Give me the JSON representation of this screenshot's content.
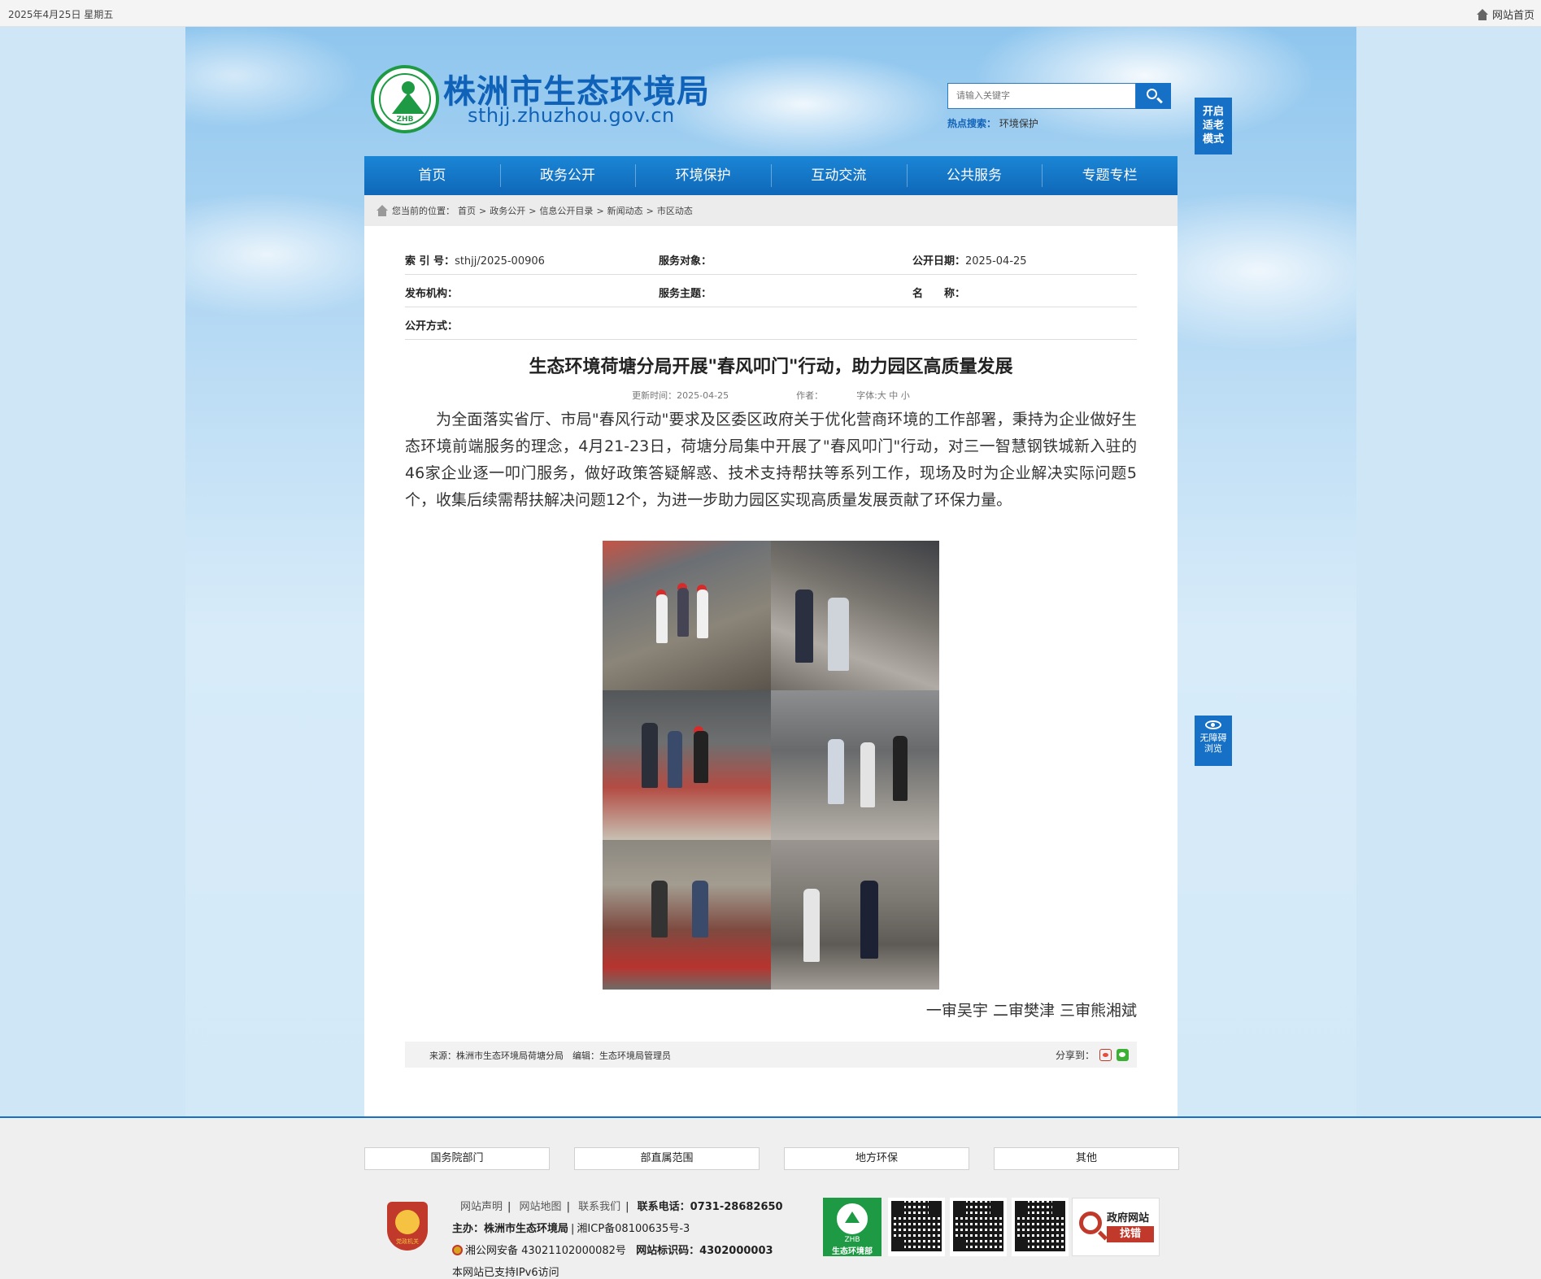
{
  "topbar": {
    "date": "2025年4月25日 星期五",
    "home_link": "网站首页"
  },
  "header": {
    "logo_text": "ZHB",
    "title": "株洲市生态环境局",
    "url": "sthjj.zhuzhou.gov.cn",
    "search_placeholder": "请输入关键字",
    "hot_label": "热点搜索：",
    "hot_term": "环境保护",
    "elder_mode": "开启\n适老\n模式",
    "accessibility": "无障碍\n浏览"
  },
  "nav": [
    "首页",
    "政务公开",
    "环境保护",
    "互动交流",
    "公共服务",
    "专题专栏"
  ],
  "breadcrumb": {
    "label": "您当前的位置：",
    "items": [
      "首页",
      "政务公开",
      "信息公开目录",
      "新闻动态",
      "市区动态"
    ],
    "sep": ">"
  },
  "meta": {
    "index_label": "索 引 号：",
    "index_value": "sthjj/2025-00906",
    "target_label": "服务对象：",
    "date_label": "公开日期：",
    "date_value": "2025-04-25",
    "org_label": "发布机构：",
    "topic_label": "服务主题：",
    "name_label": "名　　称：",
    "mode_label": "公开方式："
  },
  "article": {
    "title": "生态环境荷塘分局开展\"春风叩门\"行动，助力园区高质量发展",
    "update_label": "更新时间：",
    "update_value": "2025-04-25",
    "author_label": "作者：",
    "font_label": "字体:大 中 小",
    "body": "为全面落实省厅、市局\"春风行动\"要求及区委区政府关于优化营商环境的工作部署，秉持为企业做好生态环境前端服务的理念，4月21-23日，荷塘分局集中开展了\"春风叩门\"行动，对三一智慧钢铁城新入驻的46家企业逐一叩门服务，做好政策答疑解惑、技术支持帮扶等系列工作，现场及时为企业解决实际问题5个，收集后续需帮扶解决问题12个，为进一步助力园区实现高质量发展贡献了环保力量。",
    "signature": "一审吴宇 二审樊津 三审熊湘斌",
    "source": "来源：株洲市生态环境局荷塘分局　编辑：生态环境局管理员",
    "share_label": "分享到："
  },
  "footer": {
    "selects": [
      "国务院部门",
      "部直属范围",
      "地方环保",
      "其他"
    ],
    "links": [
      "网站声明",
      "网站地图",
      "联系我们"
    ],
    "phone_label": "联系电话：",
    "phone": "0731-28682650",
    "host": "主办：株洲市生态环境局",
    "icp": "湘ICP备08100635号-3",
    "police": "湘公网安备 43021102000082号",
    "site_id_label": "网站标识码：",
    "site_id": "4302000003",
    "ipv6": "本网站已支持IPv6访问",
    "badge_text": "党政机关",
    "zhb_text": "ZHB",
    "zhb_label": "生态环境部",
    "gov_title": "政府网站",
    "gov_action": "找错"
  }
}
